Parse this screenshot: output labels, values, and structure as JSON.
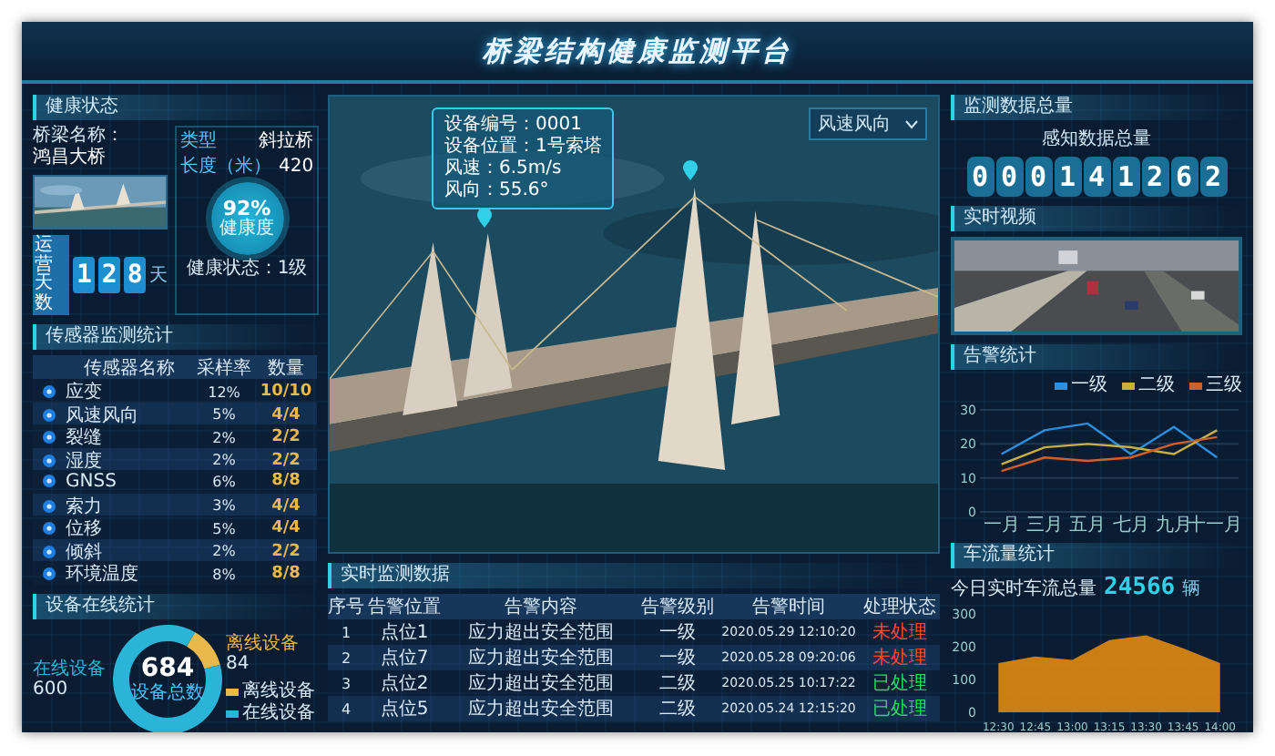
{
  "title": "桥梁结构健康监测平台",
  "health": {
    "heading": "健康状态",
    "name_label": "桥梁名称：",
    "name": "鸿昌大桥",
    "type_label": "类型",
    "type": "斜拉桥",
    "length_label": "长度（米）",
    "length": "420",
    "days_label": "运营天数",
    "days": [
      "1",
      "2",
      "8"
    ],
    "days_unit": "天",
    "score": "92%",
    "score_label": "健康度",
    "status": "健康状态：1级"
  },
  "sensors": {
    "heading": "传感器监测统计",
    "columns": [
      "传感器名称",
      "采样率",
      "数量"
    ],
    "rows": [
      {
        "name": "应变",
        "rate": "12%",
        "count": "10/10"
      },
      {
        "name": "风速风向",
        "rate": "5%",
        "count": "4/4"
      },
      {
        "name": "裂缝",
        "rate": "2%",
        "count": "2/2"
      },
      {
        "name": "湿度",
        "rate": "2%",
        "count": "2/2"
      },
      {
        "name": "GNSS",
        "rate": "6%",
        "count": "8/8"
      },
      {
        "name": "索力",
        "rate": "3%",
        "count": "4/4"
      },
      {
        "name": "位移",
        "rate": "5%",
        "count": "4/4"
      },
      {
        "name": "倾斜",
        "rate": "2%",
        "count": "2/2"
      },
      {
        "name": "环境温度",
        "rate": "8%",
        "count": "8/8"
      }
    ]
  },
  "devices": {
    "heading": "设备在线统计",
    "total": "684",
    "total_label": "设备总数",
    "chart_data": {
      "type": "donut",
      "categories": [
        "离线设备",
        "在线设备"
      ],
      "values": [
        12.3,
        87.7
      ]
    },
    "callout_values": [
      "84",
      "600"
    ],
    "legend": [
      {
        "label": "离线设备",
        "color": "#e8b84a"
      },
      {
        "label": "在线设备",
        "color": "#2ab4d8"
      }
    ]
  },
  "viewer": {
    "dropdown": "风速风向",
    "tooltip": [
      "设备编号：0001",
      "设备位置：1号索塔",
      "风速：6.5m/s",
      "风向：55.6°"
    ]
  },
  "alarms": {
    "heading": "实时监测数据",
    "columns": [
      "序号",
      "告警位置",
      "告警内容",
      "告警级别",
      "告警时间",
      "处理状态"
    ],
    "rows": [
      {
        "no": "1",
        "place": "点位1",
        "content": "应力超出安全范围",
        "level": "一级",
        "time": "2020.05.29 12:10:20",
        "status": "未处理",
        "handled": false
      },
      {
        "no": "2",
        "place": "点位7",
        "content": "应力超出安全范围",
        "level": "一级",
        "time": "2020.05.28 09:20:06",
        "status": "未处理",
        "handled": false
      },
      {
        "no": "3",
        "place": "点位2",
        "content": "应力超出安全范围",
        "level": "二级",
        "time": "2020.05.25 10:17:22",
        "status": "已处理",
        "handled": true
      },
      {
        "no": "4",
        "place": "点位5",
        "content": "应力超出安全范围",
        "level": "二级",
        "time": "2020.05.24 12:15:20",
        "status": "已处理",
        "handled": true
      }
    ]
  },
  "totals": {
    "heading": "监测数据总量",
    "label": "感知数据总量",
    "digits": [
      "0",
      "0",
      "0",
      "1",
      "4",
      "1",
      "2",
      "6",
      "2"
    ]
  },
  "video": {
    "heading": "实时视频"
  },
  "alarm_stats": {
    "heading": "告警统计",
    "chart_data": {
      "type": "line",
      "categories": [
        "一月",
        "三月",
        "五月",
        "七月",
        "九月",
        "十一月"
      ],
      "ylim": [
        0,
        30
      ],
      "yticks": [
        0,
        10,
        20,
        30
      ],
      "series": [
        {
          "name": "一级",
          "color": "#2b8fe0",
          "values": [
            17,
            24,
            26,
            17,
            25,
            16
          ]
        },
        {
          "name": "二级",
          "color": "#c8b040",
          "values": [
            14,
            19,
            20,
            19,
            17,
            24
          ]
        },
        {
          "name": "三级",
          "color": "#d0602a",
          "values": [
            12,
            16,
            15,
            16,
            20,
            22
          ]
        }
      ]
    }
  },
  "traffic": {
    "heading": "车流量统计",
    "label": "今日实时车流总量",
    "value": "24566",
    "unit": "辆",
    "chart_data": {
      "type": "area",
      "categories": [
        "12:30",
        "12:45",
        "13:00",
        "13:15",
        "13:30",
        "13:45",
        "14:00"
      ],
      "ylim": [
        0,
        300
      ],
      "yticks": [
        0,
        100,
        200,
        300
      ],
      "series": [
        {
          "color": "#e08a10",
          "values": [
            150,
            170,
            160,
            220,
            235,
            195,
            150
          ]
        }
      ]
    }
  }
}
